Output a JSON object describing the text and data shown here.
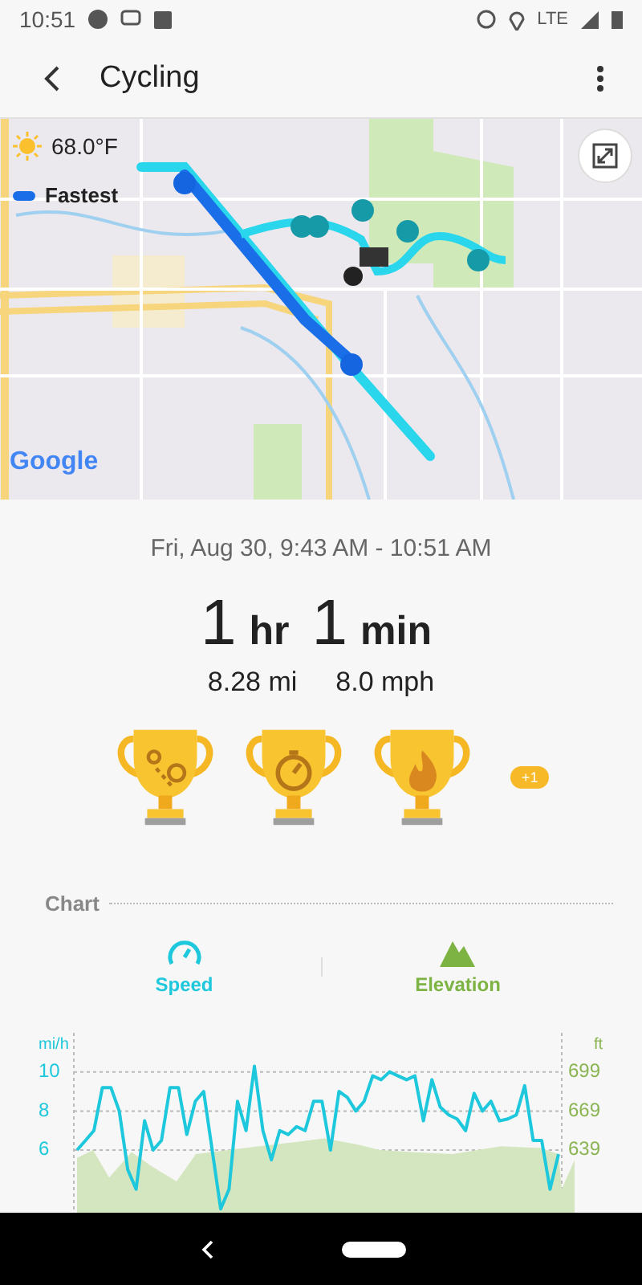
{
  "status_bar": {
    "time": "10:51",
    "network": "LTE"
  },
  "app_bar": {
    "title": "Cycling"
  },
  "map": {
    "kind": "picture",
    "weather": "68.0°F",
    "legend": "Fastest",
    "attribution": "Google"
  },
  "summary": {
    "date_range": "Fri, Aug 30, 9:43 AM - 10:51 AM",
    "duration": [
      {
        "value": "1",
        "unit": "hr"
      },
      {
        "value": "1",
        "unit": "min"
      }
    ],
    "stats": [
      "8.28 mi",
      "8.0 mph"
    ]
  },
  "trophies": [
    {
      "kind": "route"
    },
    {
      "kind": "stopwatch"
    },
    {
      "kind": "flame"
    }
  ],
  "more_badge": "+1",
  "chart": {
    "title": "Chart",
    "tabs": [
      {
        "label": "Speed",
        "kind": "speed",
        "color": "#1ec8dc"
      },
      {
        "label": "Elevation",
        "kind": "elevation",
        "color": "#7cb342"
      }
    ],
    "right_unit": "ft",
    "right_ticks": [
      "699",
      "669",
      "639"
    ],
    "chart_data": {
      "type": "line",
      "ylabel": "mi/h",
      "yticks": [
        6,
        8,
        10
      ],
      "ylim": [
        2.8,
        12
      ],
      "grid": true,
      "series": [
        {
          "color": "#1ec8dc",
          "values": [
            6,
            6.5,
            7,
            9.2,
            9.2,
            8,
            5,
            4,
            7.5,
            6,
            6.5,
            9.2,
            9.2,
            6.8,
            8.5,
            9,
            6,
            3,
            4,
            8.5,
            7,
            10.3,
            7,
            5.5,
            7,
            6.8,
            7.2,
            7,
            8.5,
            8.5,
            6,
            9,
            8.7,
            8,
            8.5,
            9.8,
            9.6,
            10,
            9.8,
            9.6,
            9.8,
            7.5,
            9.6,
            8.2,
            7.8,
            7.6,
            7,
            8.9,
            8,
            8.5,
            7.5,
            7.6,
            7.8,
            9.3,
            6.5,
            6.5,
            4,
            5.8
          ]
        }
      ]
    }
  }
}
